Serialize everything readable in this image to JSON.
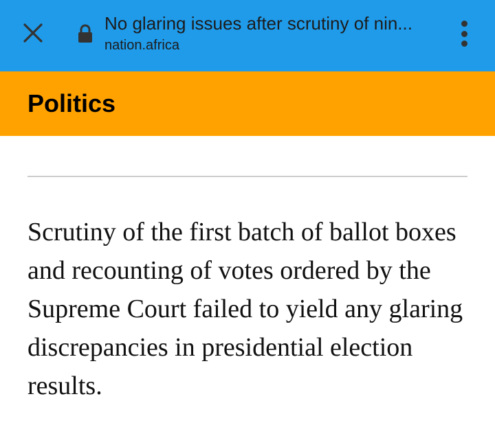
{
  "browser": {
    "page_title": "No glaring issues after scrutiny of nin...",
    "url": "nation.africa",
    "icons": {
      "close": "close-icon",
      "lock": "lock-icon",
      "menu": "more-vert-icon"
    },
    "colors": {
      "toolbar": "#1f9bea"
    }
  },
  "section": {
    "label": "Politics",
    "color": "#ffa200"
  },
  "article": {
    "lead": "Scrutiny of the first batch of ballot boxes and recounting of votes ordered by the Supreme Court failed to yield any glaring discrepancies in presidential election results."
  }
}
